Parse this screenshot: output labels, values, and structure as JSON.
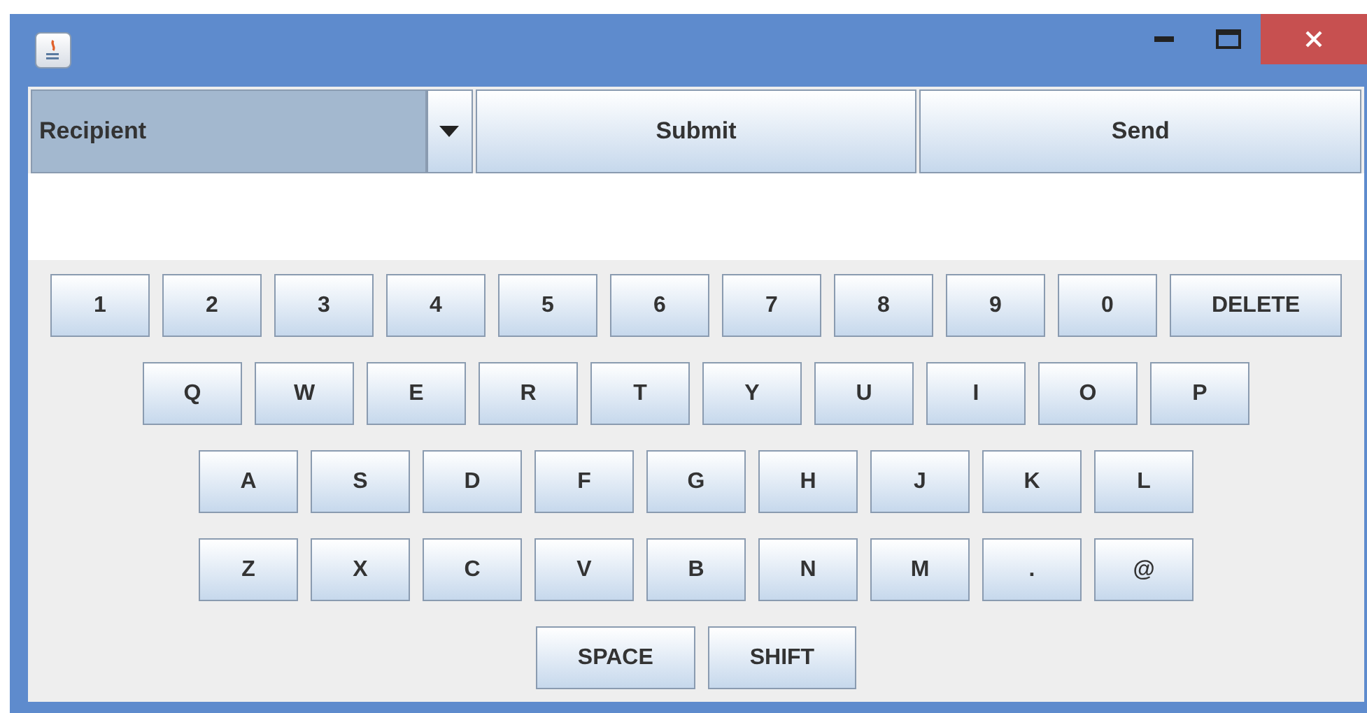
{
  "recipient_dropdown": {
    "value": "Recipient"
  },
  "top_buttons": [
    "Submit",
    "Send"
  ],
  "keyboard": {
    "rows": [
      [
        {
          "label": "1",
          "kind": "normal"
        },
        {
          "label": "2",
          "kind": "normal"
        },
        {
          "label": "3",
          "kind": "normal"
        },
        {
          "label": "4",
          "kind": "normal"
        },
        {
          "label": "5",
          "kind": "normal"
        },
        {
          "label": "6",
          "kind": "normal"
        },
        {
          "label": "7",
          "kind": "normal"
        },
        {
          "label": "8",
          "kind": "normal"
        },
        {
          "label": "9",
          "kind": "normal"
        },
        {
          "label": "0",
          "kind": "normal"
        },
        {
          "label": "DELETE",
          "kind": "wide"
        }
      ],
      [
        {
          "label": "Q",
          "kind": "normal"
        },
        {
          "label": "W",
          "kind": "normal"
        },
        {
          "label": "E",
          "kind": "normal"
        },
        {
          "label": "R",
          "kind": "normal"
        },
        {
          "label": "T",
          "kind": "normal"
        },
        {
          "label": "Y",
          "kind": "normal"
        },
        {
          "label": "U",
          "kind": "normal"
        },
        {
          "label": "I",
          "kind": "normal"
        },
        {
          "label": "O",
          "kind": "normal"
        },
        {
          "label": "P",
          "kind": "normal"
        }
      ],
      [
        {
          "label": "A",
          "kind": "normal"
        },
        {
          "label": "S",
          "kind": "normal"
        },
        {
          "label": "D",
          "kind": "normal"
        },
        {
          "label": "F",
          "kind": "normal"
        },
        {
          "label": "G",
          "kind": "normal"
        },
        {
          "label": "H",
          "kind": "normal"
        },
        {
          "label": "J",
          "kind": "normal"
        },
        {
          "label": "K",
          "kind": "normal"
        },
        {
          "label": "L",
          "kind": "normal"
        }
      ],
      [
        {
          "label": "Z",
          "kind": "normal"
        },
        {
          "label": "X",
          "kind": "normal"
        },
        {
          "label": "C",
          "kind": "normal"
        },
        {
          "label": "V",
          "kind": "normal"
        },
        {
          "label": "B",
          "kind": "normal"
        },
        {
          "label": "N",
          "kind": "normal"
        },
        {
          "label": "M",
          "kind": "normal"
        },
        {
          "label": ".",
          "kind": "normal"
        },
        {
          "label": "@",
          "kind": "normal"
        }
      ],
      [
        {
          "label": "SPACE",
          "kind": "wide"
        },
        {
          "label": "SHIFT",
          "kind": "wide"
        }
      ]
    ]
  }
}
